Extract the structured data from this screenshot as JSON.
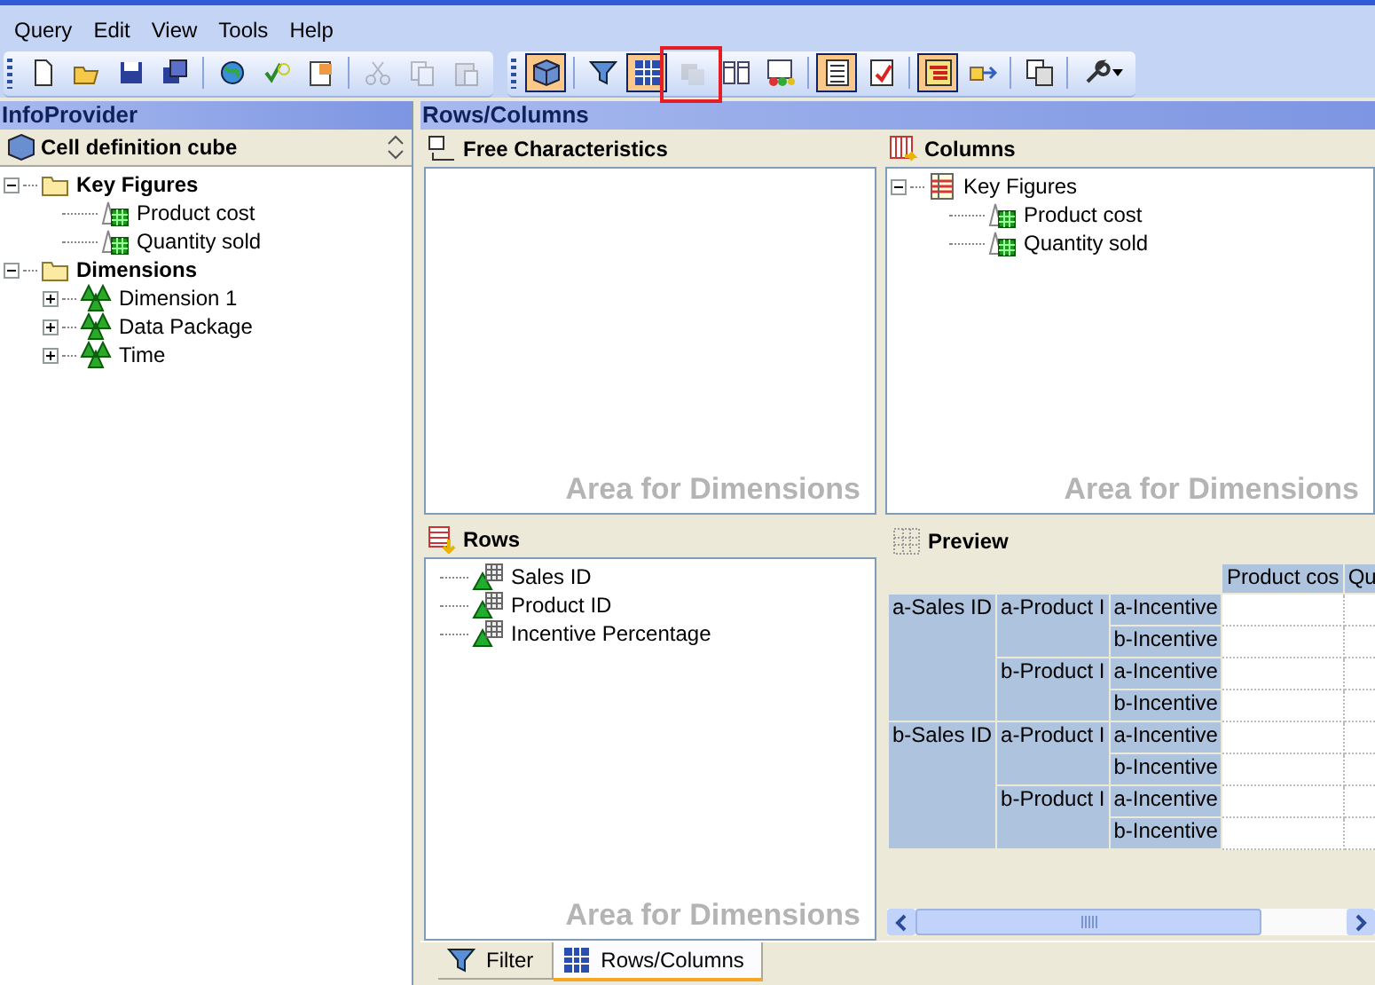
{
  "menu": [
    "Query",
    "Edit",
    "View",
    "Tools",
    "Help"
  ],
  "toolbars": [
    {
      "groups": [
        [
          {
            "pressed": false,
            "disabled": false
          },
          {
            "pressed": false,
            "disabled": false
          },
          {
            "pressed": false,
            "disabled": false
          },
          {
            "pressed": false,
            "disabled": false
          }
        ],
        [
          {
            "pressed": false,
            "disabled": false
          },
          {
            "pressed": false,
            "disabled": false
          },
          {
            "pressed": false,
            "disabled": false
          }
        ],
        [
          {
            "pressed": false,
            "disabled": true
          },
          {
            "pressed": false,
            "disabled": true
          },
          {
            "pressed": false,
            "disabled": true
          }
        ]
      ]
    },
    {
      "groups": [
        [
          {
            "pressed": true,
            "disabled": false
          }
        ],
        [
          {
            "pressed": false,
            "disabled": false
          },
          {
            "pressed": true,
            "disabled": false
          },
          {
            "pressed": false,
            "disabled": true,
            "highlighted": true
          },
          {
            "pressed": false,
            "disabled": false
          },
          {
            "pressed": false,
            "disabled": false
          }
        ],
        [
          {
            "pressed": true,
            "disabled": false
          },
          {
            "pressed": false,
            "disabled": false
          }
        ],
        [
          {
            "pressed": true,
            "disabled": false
          },
          {
            "pressed": false,
            "disabled": false
          }
        ],
        [
          {
            "pressed": false,
            "disabled": false
          }
        ],
        [
          {
            "pressed": false,
            "disabled": false,
            "dropdown": true
          }
        ]
      ]
    }
  ],
  "left_panel": {
    "title": "InfoProvider",
    "cube": "Cell definition cube",
    "tree": [
      {
        "label": "Key Figures",
        "kind": "folder",
        "expanded": true,
        "children": [
          {
            "label": "Product cost",
            "kind": "keyfigure"
          },
          {
            "label": "Quantity sold",
            "kind": "keyfigure"
          }
        ]
      },
      {
        "label": "Dimensions",
        "kind": "folder",
        "expanded": true,
        "children": [
          {
            "label": "Dimension 1",
            "kind": "dimension",
            "expanded": false
          },
          {
            "label": "Data Package",
            "kind": "dimension",
            "expanded": false
          },
          {
            "label": "Time",
            "kind": "dimension",
            "expanded": false
          }
        ]
      }
    ]
  },
  "main": {
    "title": "Rows/Columns",
    "free_characteristics": {
      "title": "Free Characteristics",
      "watermark": "Area for Dimensions"
    },
    "columns": {
      "title": "Columns",
      "watermark": "Area for Dimensions",
      "tree": [
        {
          "label": "Key Figures",
          "kind": "structure",
          "expanded": true,
          "children": [
            {
              "label": "Product cost",
              "kind": "keyfigure"
            },
            {
              "label": "Quantity sold",
              "kind": "keyfigure"
            }
          ]
        }
      ]
    },
    "rows": {
      "title": "Rows",
      "watermark": "Area for Dimensions",
      "items": [
        "Sales ID",
        "Product ID",
        "Incentive Percentage"
      ]
    },
    "preview": {
      "title": "Preview",
      "columns": [
        "Product cos",
        "Qu"
      ],
      "rows": [
        {
          "label": "a-Sales ID",
          "children": [
            {
              "label": "a-Product I",
              "children": [
                "a-Incentive",
                "b-Incentive"
              ]
            },
            {
              "label": "b-Product I",
              "children": [
                "a-Incentive",
                "b-Incentive"
              ]
            }
          ]
        },
        {
          "label": "b-Sales ID",
          "children": [
            {
              "label": "a-Product I",
              "children": [
                "a-Incentive",
                "b-Incentive"
              ]
            },
            {
              "label": "b-Product I",
              "children": [
                "a-Incentive",
                "b-Incentive"
              ]
            }
          ]
        }
      ]
    }
  },
  "tabs": [
    {
      "label": "Filter",
      "selected": false
    },
    {
      "label": "Rows/Columns",
      "selected": true
    }
  ]
}
